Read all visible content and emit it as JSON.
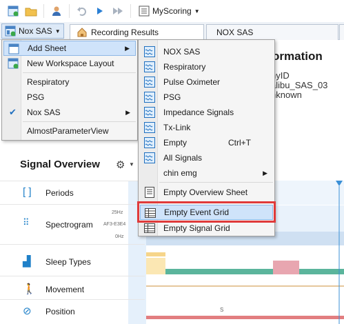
{
  "toolbar": {
    "scoring_label": "MyScoring",
    "icons": [
      "new-workspace-icon",
      "open-folder-icon",
      "user-icon",
      "undo-icon",
      "play-icon",
      "fast-forward-icon",
      "scoring-icon"
    ]
  },
  "tabs": {
    "workspace_label": "Nox SAS",
    "items": [
      {
        "label": "Recording Results"
      },
      {
        "label": "NOX SAS"
      }
    ]
  },
  "workspace_menu": {
    "items": [
      {
        "label": "Add Sheet",
        "has_submenu": true,
        "highlighted": true
      },
      {
        "label": "New Workspace Layout"
      },
      {
        "label": "Respiratory"
      },
      {
        "label": "PSG"
      },
      {
        "label": "Nox SAS",
        "checked": true,
        "has_submenu": true
      },
      {
        "label": "AlmostParameterView"
      }
    ]
  },
  "add_sheet_menu": {
    "items": [
      {
        "label": "NOX SAS"
      },
      {
        "label": "Respiratory"
      },
      {
        "label": "Pulse Oximeter"
      },
      {
        "label": "PSG"
      },
      {
        "label": "Impedance Signals"
      },
      {
        "label": "Tx-Link"
      },
      {
        "label": "Empty",
        "shortcut": "Ctrl+T"
      },
      {
        "label": "All Signals"
      },
      {
        "label": "chin emg",
        "has_submenu": true
      },
      {
        "label": "Empty Overview Sheet"
      },
      {
        "label": "Empty Event Grid",
        "highlighted": true
      },
      {
        "label": "Empty Signal Grid"
      }
    ]
  },
  "info": {
    "title": "ormation",
    "lines": [
      "nyID",
      "alibu_SAS_03",
      "nknown"
    ]
  },
  "overview": {
    "title": "Signal Overview",
    "freq_labels": [
      "25Hz",
      "AF3-E3E4",
      "0Hz"
    ],
    "rows": [
      {
        "label": "Periods"
      },
      {
        "label": "Spectrogram"
      },
      {
        "label": "Sleep Types"
      },
      {
        "label": "Movement"
      },
      {
        "label": "Position"
      }
    ],
    "position_marker": "S"
  }
}
